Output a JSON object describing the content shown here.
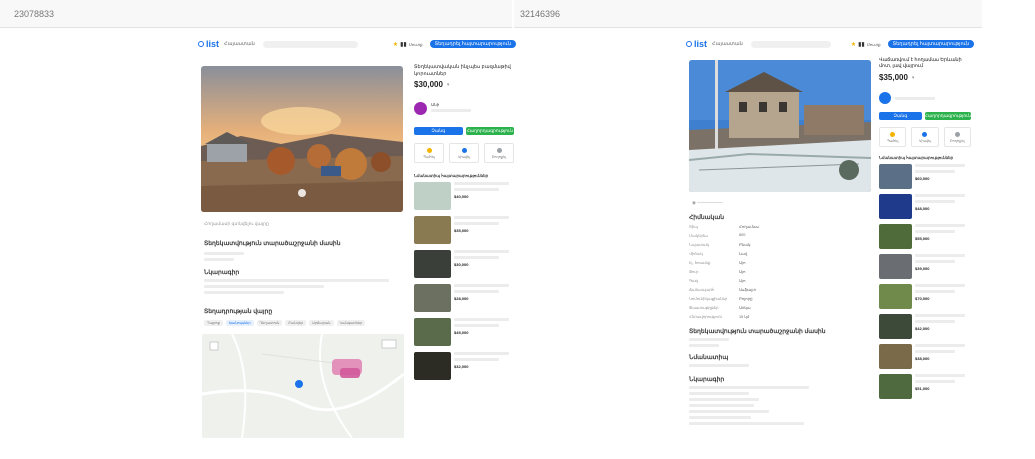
{
  "top": {
    "left_id": "23078833",
    "right_id": "32146396"
  },
  "left": {
    "header": {
      "logo": "list",
      "region": "Հայաստան",
      "post_button": "Տեղադրել հայտարարություն",
      "login": "Մուտք"
    },
    "title": "Տեղեկատվական ինչպես բազմաթիվ կորուստներ",
    "price": "$30,000",
    "seller_name": "Անի",
    "call_label": "Զանգ",
    "message_label": "Հաղորդագրություն",
    "mini_actions": [
      "Պահել",
      "Կիսվել",
      "Բողոքել"
    ],
    "similar_title": "Նմանատիպ հայտարարություններ",
    "similar_prices": [
      "$40,000",
      "$35,000",
      "$30,000",
      "$28,000",
      "$45,000",
      "$32,000"
    ],
    "map_note": "Հողամասի գտնվելու վայրը",
    "section_title": "Տեղեկատվություն տարածաշրջանի մասին",
    "desc_title": "Նկարագիր",
    "location_title": "Տեղադրության վայրը",
    "tabs": [
      "Դպրոց",
      "Խանութներ",
      "Դեղատուն",
      "Բանկեր",
      "Սրճարան",
      "Կանգառներ"
    ]
  },
  "right": {
    "header": {
      "logo": "list",
      "region": "Հայաստան",
      "post_button": "Տեղադրել հայտարարություն",
      "login": "Մուտք"
    },
    "title": "Վաճառվում է հողամաս Երևանի մոտ, լավ վայրում",
    "price": "$35,000",
    "call_label": "Զանգ",
    "message_label": "Հաղորդագրություն",
    "mini_actions": [
      "Պահել",
      "Կիսվել",
      "Բողոքել"
    ],
    "similar_title": "Նմանատիպ հայտարարություններ",
    "similar_prices": [
      "$60,000",
      "$48,000",
      "$55,000",
      "$39,000",
      "$70,000",
      "$42,000",
      "$38,000",
      "$51,000"
    ],
    "specs_title": "Հիմնական",
    "specs": [
      {
        "k": "Տիպ",
        "v": "Հողամաս"
      },
      {
        "k": "Մակերես",
        "v": "600"
      },
      {
        "k": "Նպատակ",
        "v": "Բնակ."
      },
      {
        "k": "Վիճակ",
        "v": "Լավ"
      },
      {
        "k": "Էլ. հոսանք",
        "v": "Այո"
      },
      {
        "k": "Ջուր",
        "v": "Այո"
      },
      {
        "k": "Գազ",
        "v": "Այո"
      },
      {
        "k": "Ճանապարհ",
        "v": "Ասֆալտ"
      },
      {
        "k": "Կոմունիկացիաներ",
        "v": "Բոլորը"
      },
      {
        "k": "Փաստաթղթեր",
        "v": "Առկա"
      },
      {
        "k": "Հեռավորություն",
        "v": "15 կմ"
      }
    ],
    "section_title": "Տեղեկատվություն տարածաշրջանի մասին",
    "extra_title": "Նմանատիպ",
    "desc_title": "Նկարագիր"
  },
  "colors": {
    "accent": "#1a73e8",
    "green": "#2bb24c"
  }
}
